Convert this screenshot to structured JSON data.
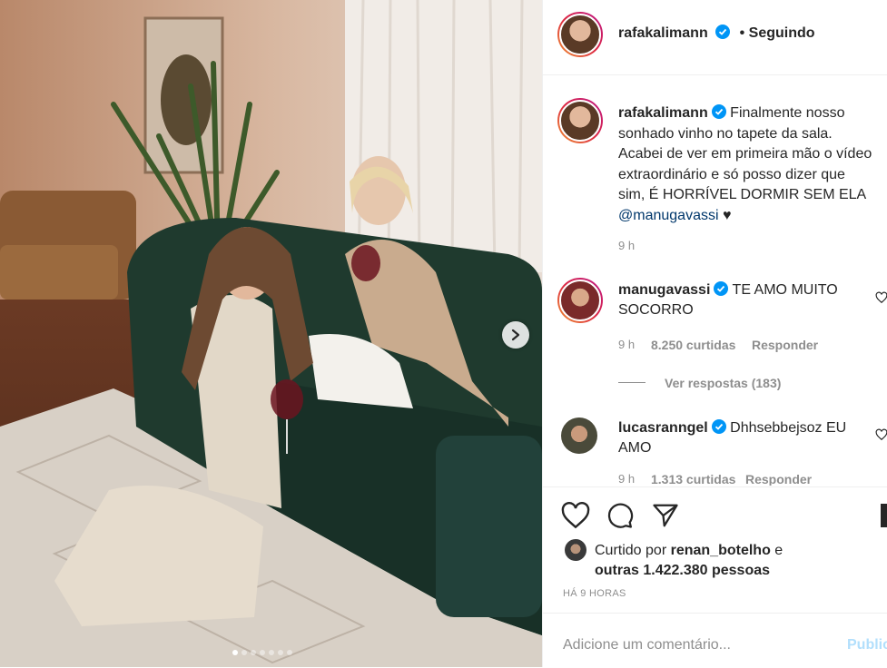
{
  "post": {
    "author": "rafakalimann",
    "follow_status": "• Seguindo",
    "caption_text": "Finalmente nosso sonhado vinho no tapete da sala. Acabei de ver em primeira mão o vídeo extraordinário e só posso dizer que sim, É HORRÍVEL DORMIR SEM ELA",
    "caption_mention": "@manugavassi",
    "caption_heart": "♥",
    "caption_time": "9 h",
    "carousel_count": 7,
    "carousel_active": 0
  },
  "comments": [
    {
      "username": "manugavassi",
      "text": "TE AMO MUITO SOCORRO",
      "time": "9 h",
      "likes": "8.250 curtidas",
      "reply_label": "Responder",
      "view_replies": "Ver respostas (183)"
    },
    {
      "username": "lucasranngel",
      "text": "Dhhsebbejsoz EU AMO",
      "time": "9 h",
      "likes": "1.313 curtidas",
      "reply_label": "Responder"
    }
  ],
  "likes": {
    "prefix": "Curtido por",
    "user": "renan_botelho",
    "conj": "e",
    "others": "outras 1.422.380 pessoas"
  },
  "post_age": "HÁ 9 HORAS",
  "comment_input": {
    "placeholder": "Adicione um comentário...",
    "publish_label": "Publicar"
  },
  "icons": {
    "like": "heart-icon",
    "comment": "comment-icon",
    "share": "paper-plane-icon",
    "save": "bookmark-icon",
    "verified": "verified-badge-icon",
    "next": "chevron-right-icon"
  },
  "colors": {
    "verified": "#0095f6",
    "mention": "#00376b",
    "muted": "#8e8e8e",
    "publish_disabled": "#b2dffc"
  }
}
